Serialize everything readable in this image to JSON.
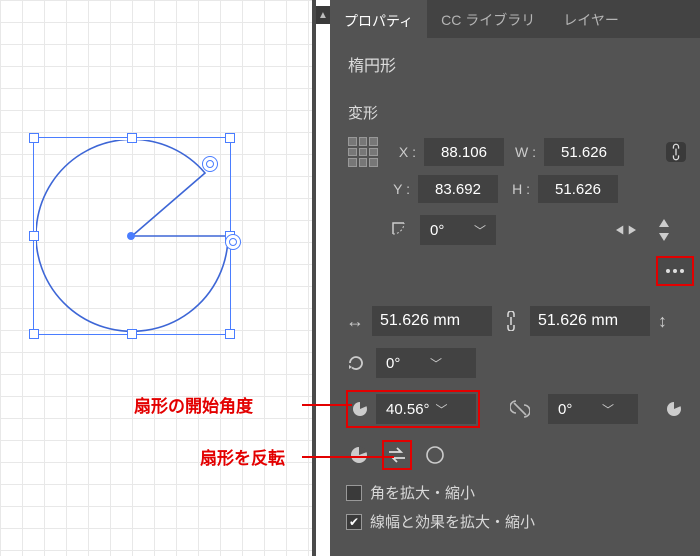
{
  "tabs": {
    "properties": "プロパティ",
    "cclib": "CC ライブラリ",
    "layers": "レイヤー"
  },
  "shape_name": "楕円形",
  "transform": {
    "title": "変形",
    "x_label": "X :",
    "x": "88.106",
    "y_label": "Y :",
    "y": "83.692",
    "w_label": "W :",
    "w": "51.626",
    "h_label": "H :",
    "h": "51.626",
    "rotate": "0°"
  },
  "dims": {
    "width": "51.626 mm",
    "height": "51.626 mm"
  },
  "rotate2": "0°",
  "pie": {
    "start": "40.56°",
    "end": "0°"
  },
  "checks": {
    "scale_corners": "角を拡大・縮小",
    "scale_strokes": "線幅と効果を拡大・縮小"
  },
  "annotations": {
    "pie_start": "扇形の開始角度",
    "invert": "扇形を反転"
  },
  "chart_data": null
}
